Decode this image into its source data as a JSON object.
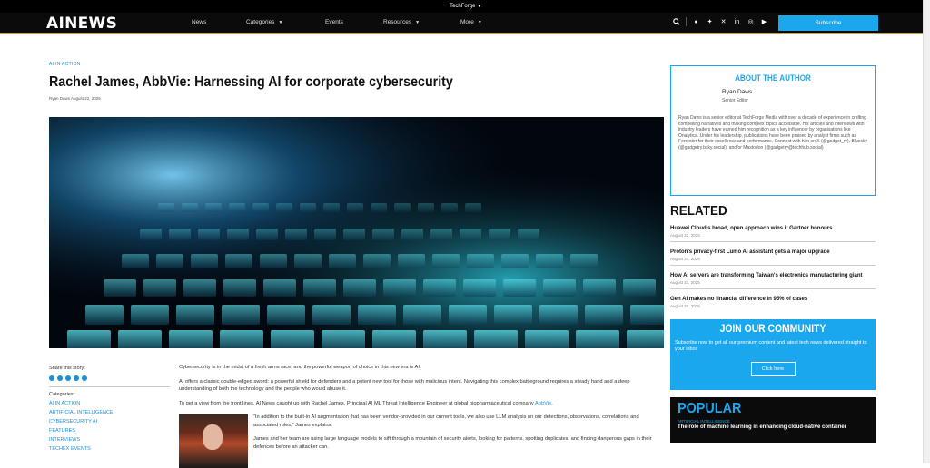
{
  "topbar": {
    "brand": "TechForge"
  },
  "nav": {
    "logo": "AINEWS",
    "items": [
      "News",
      "Categories",
      "Events",
      "Resources",
      "More"
    ],
    "subscribe": "Subscribe"
  },
  "article": {
    "category": "AI IN ACTION",
    "title": "Rachel James, AbbVie: Harnessing AI for corporate cybersecurity",
    "author": "Ryan Daws",
    "date": "August 22, 2025",
    "share_label": "Share this story:",
    "categories_label": "Categories:",
    "categories": [
      "AI IN ACTION",
      "ARTIFICIAL INTELLIGENCE",
      "CYBERSECURITY AI",
      "FEATURES",
      "INTERVIEWS",
      "TECHEX EVENTS"
    ],
    "p1": "Cybersecurity is in the midst of a fresh arms race, and the powerful weapon of choice in this new era is AI.",
    "p2": "AI offers a classic double-edged sword: a powerful shield for defenders and a potent new tool for those with malicious intent. Navigating this complex battleground requires a steady hand and a deep understanding of both the technology and the people who would abuse it.",
    "p3a": "To get a view from the front lines, AI News caught up with Rachel James, Principal AI ML Threat Intelligence Engineer at global biopharmaceutical company ",
    "p3link": "AbbVie",
    "p3b": ".",
    "quote1": "“In addition to the built-in AI augmentation that has been vendor-provided in our current tools, we also use LLM analysis on our detections, observations, correlations and associated rules,” James explains.",
    "quote2": "James and her team are using large language models to sift through a mountain of security alerts, looking for patterns, spotting duplicates, and finding dangerous gaps in their defences before an attacker can."
  },
  "author_box": {
    "heading": "ABOUT THE AUTHOR",
    "name": "Ryan Daws",
    "role": "Senior Editor",
    "bio": "Ryan Daws is a senior editor at TechForge Media with over a decade of experience in crafting compelling narratives and making complex topics accessible. His articles and interviews with industry leaders have earned him recognition as a key influencer by organisations like Onalytica. Under his leadership, publications have been praised by analyst firms such as Forrester for their excellence and performance. Connect with him on X (@gadget_ry), Bluesky (@gadgetry.bsky.social), and/or Mastodon (@gadgetry@techhub.social)"
  },
  "related": {
    "heading": "RELATED",
    "items": [
      {
        "title": "Huawei Cloud's broad, open approach wins it Gartner honours",
        "date": "August 22, 2025"
      },
      {
        "title": "Proton's privacy-first Lumo AI assistant gets a major upgrade",
        "date": "August 21, 2025"
      },
      {
        "title": "How AI servers are transforming Taiwan's electronics manufacturing giant",
        "date": "August 21, 2025"
      },
      {
        "title": "Gen AI makes no financial difference in 95% of cases",
        "date": "August 20, 2025"
      }
    ]
  },
  "community": {
    "heading": "JOIN OUR COMMUNITY",
    "text": "Subscribe now to get all our premium content and latest tech news delivered straight to your inbox",
    "button": "Click here"
  },
  "popular": {
    "heading": "POPULAR",
    "category": "ARTIFICIAL INTELLIGENCE",
    "title": "The role of machine learning in enhancing cloud-native container"
  }
}
